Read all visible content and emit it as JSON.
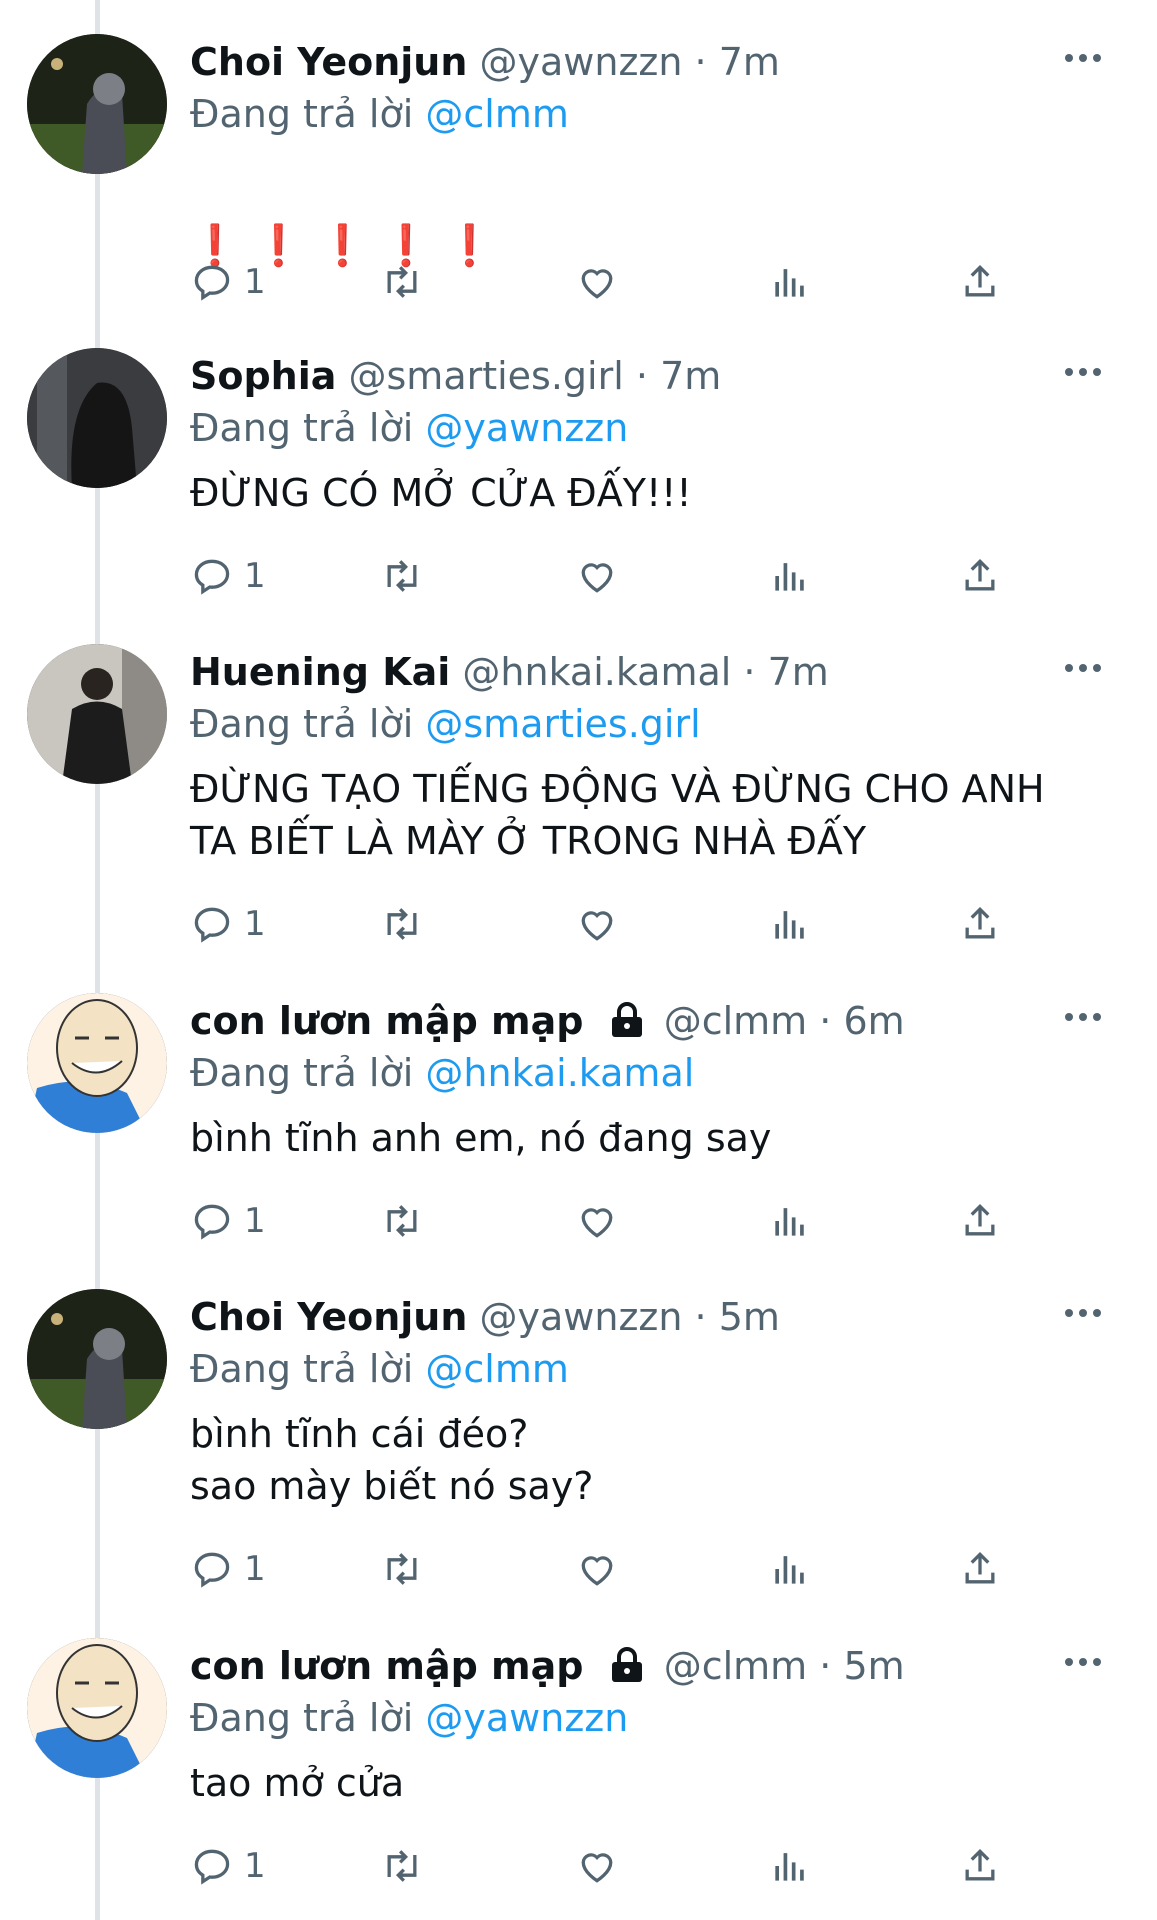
{
  "reply_prefix": "Đang trả lời",
  "tweets": [
    {
      "name": "Choi Yeonjun",
      "handle": "@yawnzzn",
      "dot": "·",
      "time": "7m",
      "reply_to": "@clmm",
      "text": "",
      "emoji": "❗ ❗ ❗ ❗ ❗",
      "reply_count": "1",
      "locked": false,
      "avatar": "photo-night-street"
    },
    {
      "name": "Sophia",
      "handle": "@smarties.girl",
      "dot": "·",
      "time": "7m",
      "reply_to": "@yawnzzn",
      "text": "ĐỪNG CÓ MỞ CỬA ĐẤY!!!",
      "reply_count": "1",
      "locked": false,
      "avatar": "photo-dark-hair"
    },
    {
      "name": "Huening Kai",
      "handle": "@hnkai.kamal",
      "dot": "·",
      "time": "7m",
      "reply_to": "@smarties.girl",
      "text": "ĐỪNG TẠO TIẾNG ĐỘNG VÀ ĐỪNG CHO ANH\nTA BIẾT LÀ MÀY Ở TRONG NHÀ ĐẤY",
      "reply_count": "1",
      "locked": false,
      "avatar": "photo-mirror-selfie"
    },
    {
      "name": "con lươn mập mạp",
      "handle": "@clmm",
      "dot": "·",
      "time": "6m",
      "reply_to": "@hnkai.kamal",
      "text": "bình tĩnh anh em, nó đang say",
      "reply_count": "1",
      "locked": true,
      "avatar": "cartoon-bald-man"
    },
    {
      "name": "Choi Yeonjun",
      "handle": "@yawnzzn",
      "dot": "·",
      "time": "5m",
      "reply_to": "@clmm",
      "text": "bình tĩnh cái đéo?\nsao mày biết nó say?",
      "reply_count": "1",
      "locked": false,
      "avatar": "photo-night-street"
    },
    {
      "name": "con lươn mập mạp",
      "handle": "@clmm",
      "dot": "·",
      "time": "5m",
      "reply_to": "@yawnzzn",
      "text": "tao mở cửa",
      "reply_count": "1",
      "locked": true,
      "avatar": "cartoon-bald-man"
    }
  ],
  "colors": {
    "link": "#1d9bf0",
    "secondary": "#536471",
    "thread_line": "#dfe3e7",
    "emoji_red": "#e0222b"
  }
}
